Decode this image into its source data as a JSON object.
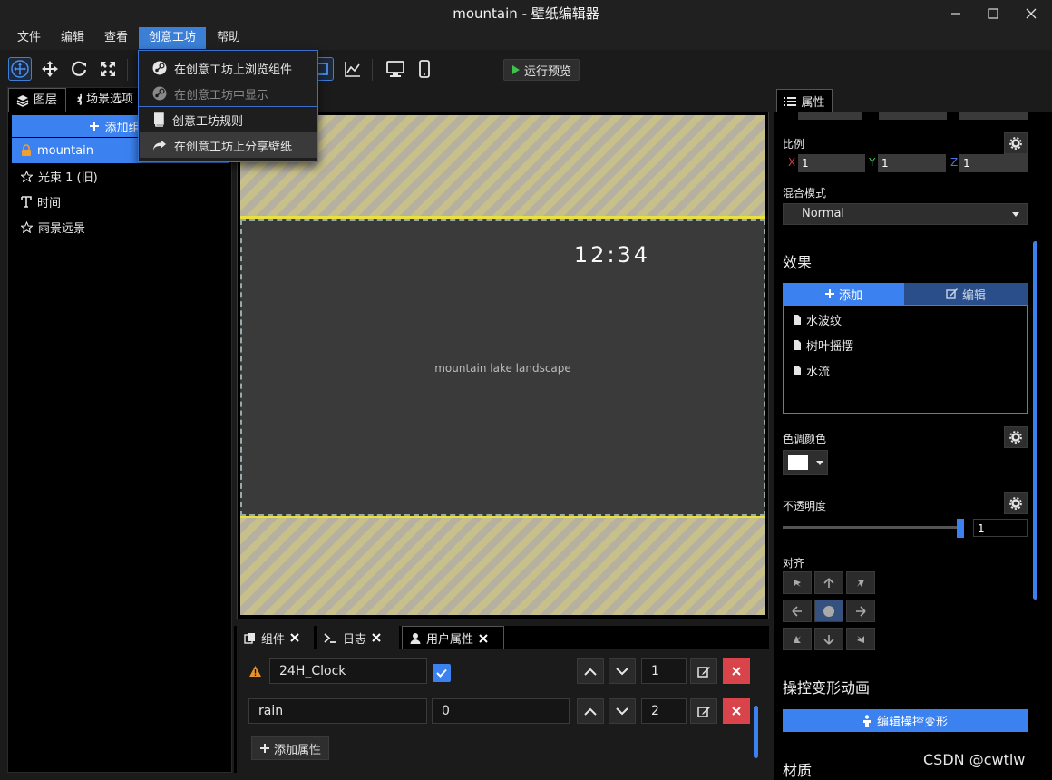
{
  "window": {
    "title": "mountain - 壁纸编辑器"
  },
  "menubar": {
    "items": [
      "文件",
      "编辑",
      "查看",
      "创意工坊",
      "帮助"
    ],
    "active": "创意工坊"
  },
  "workshop_menu": {
    "items": [
      {
        "label": "在创意工坊上浏览组件",
        "icon": "steam-icon",
        "enabled": true
      },
      {
        "label": "在创意工坊中显示",
        "icon": "steam-icon",
        "enabled": false
      },
      {
        "label": "创意工坊规则",
        "icon": "book-icon",
        "enabled": true
      },
      {
        "label": "在创意工坊上分享壁纸",
        "icon": "share-icon",
        "enabled": true
      }
    ]
  },
  "toolbar": {
    "run_preview_label": "运行预览"
  },
  "left_panel": {
    "tabs": [
      "图层",
      "场景选项"
    ],
    "add_component_label": "添加组件",
    "layers": [
      {
        "label": "mountain",
        "icon": "lock-icon",
        "selected": true
      },
      {
        "label": "光束 1 (旧)",
        "icon": "star-icon",
        "selected": false
      },
      {
        "label": "时间",
        "icon": "text-icon",
        "selected": false
      },
      {
        "label": "雨景远景",
        "icon": "star-icon",
        "selected": false
      }
    ]
  },
  "canvas": {
    "clock_text": "12:34",
    "scene_label": "mountain lake landscape"
  },
  "bottom_panel": {
    "tabs": [
      "组件",
      "日志",
      "用户属性"
    ],
    "active_tab": "用户属性",
    "properties": [
      {
        "name": "24H_Clock",
        "value_checked": true,
        "order": "1",
        "warning": true
      },
      {
        "name": "rain",
        "value": "0",
        "order": "2",
        "warning": false
      }
    ],
    "add_property_label": "添加属性"
  },
  "right_panel": {
    "tab_label": "属性",
    "scale": {
      "label": "比例",
      "x": "1",
      "y": "1",
      "z": "1"
    },
    "axis_labels": {
      "x": "X",
      "y": "Y",
      "z": "Z"
    },
    "blend": {
      "label": "混合模式",
      "value": "Normal"
    },
    "effects": {
      "title": "效果",
      "add_label": "添加",
      "edit_label": "编辑",
      "items": [
        "水波纹",
        "树叶摇摆",
        "水流"
      ]
    },
    "tint": {
      "label": "色调颜色",
      "color": "#ffffff"
    },
    "opacity": {
      "label": "不透明度",
      "value": "1",
      "fraction": 1.0
    },
    "align": {
      "label": "对齐"
    },
    "puppet": {
      "title": "操控变形动画",
      "button_label": "编辑操控变形"
    },
    "material_title": "材质"
  },
  "watermark": "CSDN @cwtlw",
  "colors": {
    "accent": "#3b82f0",
    "danger": "#d9434a"
  }
}
